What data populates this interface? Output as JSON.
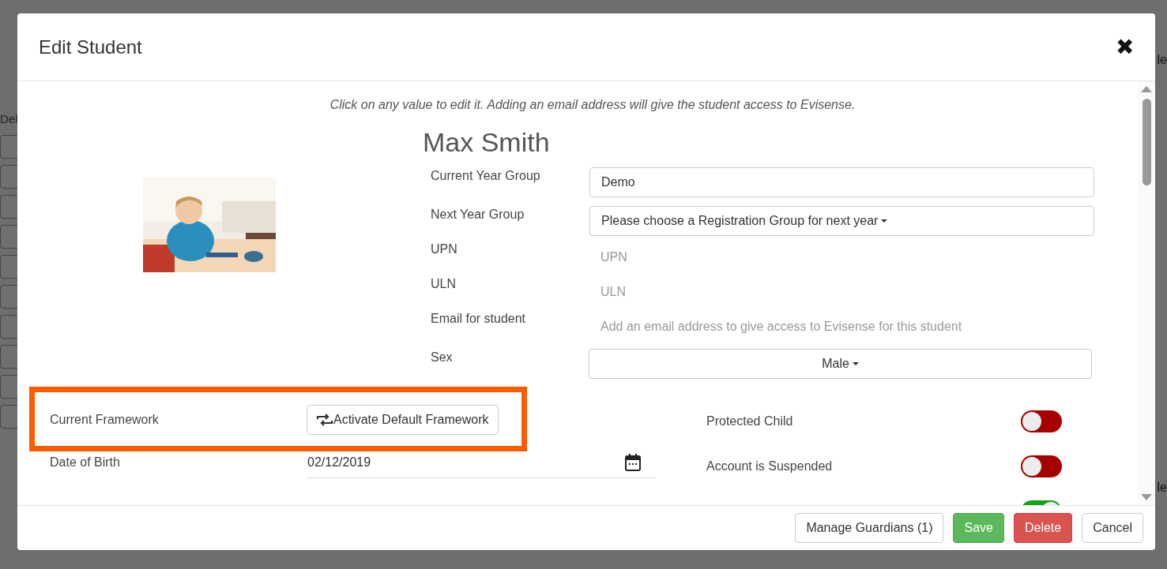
{
  "backdrop": {
    "left_texts": [
      "Del"
    ],
    "right_texts": [
      "le",
      "le"
    ]
  },
  "dialog": {
    "title": "Edit Student",
    "close": "✖",
    "note": "Click on any value to edit it. Adding an email address will give the student access to Evisense.",
    "student_name": "Max Smith",
    "fields": [
      {
        "label": "Current Year Group",
        "kind": "input",
        "value": "Demo"
      },
      {
        "label": "Next Year Group",
        "kind": "dropdown",
        "value": "Please choose a Registration Group for next year"
      },
      {
        "label": "UPN",
        "kind": "placeholder",
        "placeholder": "UPN"
      },
      {
        "label": "ULN",
        "kind": "placeholder",
        "placeholder": "ULN"
      },
      {
        "label": "Email for student",
        "kind": "placeholder",
        "placeholder": "Add an email address to give access to Evisense for this student"
      },
      {
        "label": "Sex",
        "kind": "select",
        "value": "Male"
      }
    ],
    "left_rows": [
      {
        "label": "Current Framework",
        "kind": "button",
        "value": "Activate Default Framework",
        "highlighted": true
      },
      {
        "label": "Date of Birth",
        "kind": "date",
        "value": "02/12/2019",
        "highlighted": false
      }
    ],
    "toggles": [
      {
        "label": "Protected Child",
        "on": false
      },
      {
        "label": "Account is Suspended",
        "on": false
      },
      {
        "on": true
      }
    ],
    "buttons": [
      {
        "label": "Manage Guardians (1)",
        "kind": "default"
      },
      {
        "label": "Save",
        "kind": "success"
      },
      {
        "label": "Delete",
        "kind": "danger"
      },
      {
        "label": "Cancel",
        "kind": "default"
      }
    ]
  }
}
